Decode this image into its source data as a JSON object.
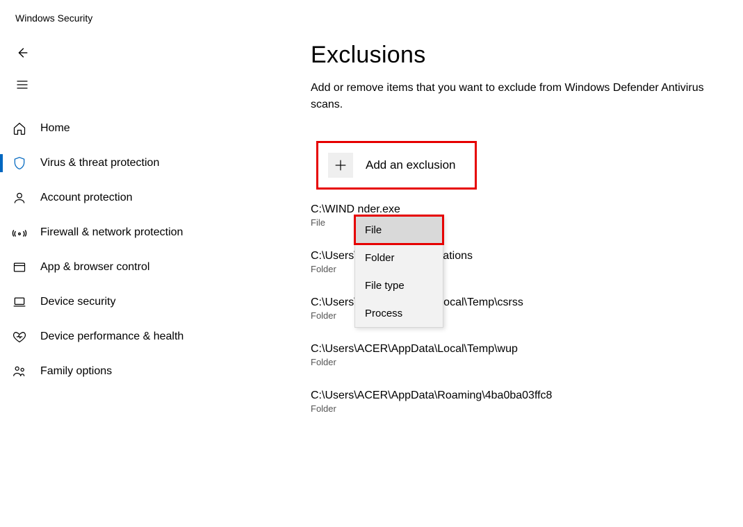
{
  "app_title": "Windows Security",
  "page": {
    "title": "Exclusions",
    "description": "Add or remove items that you want to exclude from Windows Defender Antivirus scans."
  },
  "nav": {
    "items": [
      {
        "label": "Home",
        "icon": "home"
      },
      {
        "label": "Virus & threat protection",
        "icon": "shield",
        "selected": true
      },
      {
        "label": "Account protection",
        "icon": "person"
      },
      {
        "label": "Firewall & network protection",
        "icon": "wifi"
      },
      {
        "label": "App & browser control",
        "icon": "browser"
      },
      {
        "label": "Device security",
        "icon": "laptop"
      },
      {
        "label": "Device performance & health",
        "icon": "heart"
      },
      {
        "label": "Family options",
        "icon": "family"
      }
    ]
  },
  "add_button": {
    "label": "Add an exclusion"
  },
  "dropdown": {
    "items": [
      "File",
      "Folder",
      "File type",
      "Process"
    ],
    "hovered_index": 0
  },
  "exclusions": [
    {
      "path": "C:\\WIND                               nder.exe",
      "type": "File"
    },
    {
      "path": "C:\\Users\\                              Celemony\\Separations",
      "type": "Folder"
    },
    {
      "path": "C:\\Users\\ACER\\AppData\\Local\\Temp\\csrss",
      "type": "Folder"
    },
    {
      "path": "C:\\Users\\ACER\\AppData\\Local\\Temp\\wup",
      "type": "Folder"
    },
    {
      "path": "C:\\Users\\ACER\\AppData\\Roaming\\4ba0ba03ffc8",
      "type": "Folder"
    }
  ]
}
